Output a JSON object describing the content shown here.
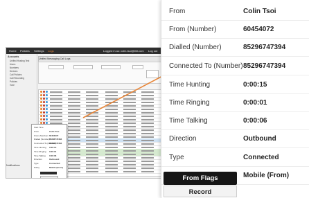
{
  "app": {
    "nav": [
      "Home",
      "Policies",
      "Settings",
      "Logs"
    ],
    "logged_in": "Logged in as: colin.tsoi@tlhl.com",
    "logout": "Log out",
    "window_title": "Unified Messaging Call Logs",
    "sidebar_heading": "Accounts",
    "sidebar_items": [
      "Unified Hosting Test",
      "Users",
      "Numbers",
      "Devices",
      "Call Policies",
      "Call Recording",
      "Policies",
      "Tone"
    ],
    "notifications_label": "Notifications"
  },
  "context_menu": {
    "items": [
      {
        "label": "Start Time",
        "value": ""
      },
      {
        "label": "From",
        "value": "Colin Tsoi"
      },
      {
        "label": "From (Number)",
        "value": "60454072"
      },
      {
        "label": "Dialled (Number)",
        "value": "85296747394"
      },
      {
        "label": "Connected To (Number)",
        "value": "85296747394"
      },
      {
        "label": "Time Hunting",
        "value": "0:00:15"
      },
      {
        "label": "Time Ringing",
        "value": "0:00:01"
      },
      {
        "label": "Time Talking",
        "value": "0:00:06"
      },
      {
        "label": "Direction",
        "value": "Outbound"
      },
      {
        "label": "Type",
        "value": "Connected"
      },
      {
        "label": "Policy",
        "value": "Mobile (From)"
      }
    ]
  },
  "details": {
    "rows": [
      {
        "label": "From",
        "value": "Colin Tsoi"
      },
      {
        "label": "From (Number)",
        "value": "60454072"
      },
      {
        "label": "Dialled (Number)",
        "value": "85296747394"
      },
      {
        "label": "Connected To (Number)",
        "value": "85296747394"
      },
      {
        "label": "Time Hunting",
        "value": "0:00:15"
      },
      {
        "label": "Time Ringing",
        "value": "0:00:01"
      },
      {
        "label": "Time Talking",
        "value": "0:00:06"
      },
      {
        "label": "Direction",
        "value": "Outbound"
      },
      {
        "label": "Type",
        "value": "Connected"
      },
      {
        "label": "Policy",
        "value": "Mobile (From)"
      }
    ],
    "buttons": {
      "flags": "From Flags",
      "record": "Record"
    }
  },
  "colors": {
    "accent_orange": "#e8873a",
    "dark_button": "#161616"
  }
}
